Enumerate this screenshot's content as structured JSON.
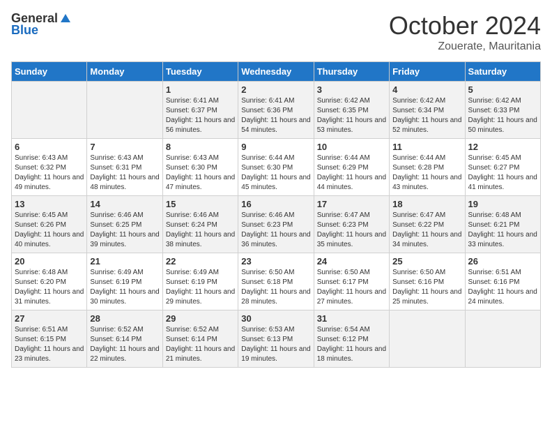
{
  "header": {
    "logo_general": "General",
    "logo_blue": "Blue",
    "month": "October 2024",
    "location": "Zouerate, Mauritania"
  },
  "days_of_week": [
    "Sunday",
    "Monday",
    "Tuesday",
    "Wednesday",
    "Thursday",
    "Friday",
    "Saturday"
  ],
  "weeks": [
    [
      {
        "day": "",
        "sunrise": "",
        "sunset": "",
        "daylight": ""
      },
      {
        "day": "",
        "sunrise": "",
        "sunset": "",
        "daylight": ""
      },
      {
        "day": "1",
        "sunrise": "Sunrise: 6:41 AM",
        "sunset": "Sunset: 6:37 PM",
        "daylight": "Daylight: 11 hours and 56 minutes."
      },
      {
        "day": "2",
        "sunrise": "Sunrise: 6:41 AM",
        "sunset": "Sunset: 6:36 PM",
        "daylight": "Daylight: 11 hours and 54 minutes."
      },
      {
        "day": "3",
        "sunrise": "Sunrise: 6:42 AM",
        "sunset": "Sunset: 6:35 PM",
        "daylight": "Daylight: 11 hours and 53 minutes."
      },
      {
        "day": "4",
        "sunrise": "Sunrise: 6:42 AM",
        "sunset": "Sunset: 6:34 PM",
        "daylight": "Daylight: 11 hours and 52 minutes."
      },
      {
        "day": "5",
        "sunrise": "Sunrise: 6:42 AM",
        "sunset": "Sunset: 6:33 PM",
        "daylight": "Daylight: 11 hours and 50 minutes."
      }
    ],
    [
      {
        "day": "6",
        "sunrise": "Sunrise: 6:43 AM",
        "sunset": "Sunset: 6:32 PM",
        "daylight": "Daylight: 11 hours and 49 minutes."
      },
      {
        "day": "7",
        "sunrise": "Sunrise: 6:43 AM",
        "sunset": "Sunset: 6:31 PM",
        "daylight": "Daylight: 11 hours and 48 minutes."
      },
      {
        "day": "8",
        "sunrise": "Sunrise: 6:43 AM",
        "sunset": "Sunset: 6:30 PM",
        "daylight": "Daylight: 11 hours and 47 minutes."
      },
      {
        "day": "9",
        "sunrise": "Sunrise: 6:44 AM",
        "sunset": "Sunset: 6:30 PM",
        "daylight": "Daylight: 11 hours and 45 minutes."
      },
      {
        "day": "10",
        "sunrise": "Sunrise: 6:44 AM",
        "sunset": "Sunset: 6:29 PM",
        "daylight": "Daylight: 11 hours and 44 minutes."
      },
      {
        "day": "11",
        "sunrise": "Sunrise: 6:44 AM",
        "sunset": "Sunset: 6:28 PM",
        "daylight": "Daylight: 11 hours and 43 minutes."
      },
      {
        "day": "12",
        "sunrise": "Sunrise: 6:45 AM",
        "sunset": "Sunset: 6:27 PM",
        "daylight": "Daylight: 11 hours and 41 minutes."
      }
    ],
    [
      {
        "day": "13",
        "sunrise": "Sunrise: 6:45 AM",
        "sunset": "Sunset: 6:26 PM",
        "daylight": "Daylight: 11 hours and 40 minutes."
      },
      {
        "day": "14",
        "sunrise": "Sunrise: 6:46 AM",
        "sunset": "Sunset: 6:25 PM",
        "daylight": "Daylight: 11 hours and 39 minutes."
      },
      {
        "day": "15",
        "sunrise": "Sunrise: 6:46 AM",
        "sunset": "Sunset: 6:24 PM",
        "daylight": "Daylight: 11 hours and 38 minutes."
      },
      {
        "day": "16",
        "sunrise": "Sunrise: 6:46 AM",
        "sunset": "Sunset: 6:23 PM",
        "daylight": "Daylight: 11 hours and 36 minutes."
      },
      {
        "day": "17",
        "sunrise": "Sunrise: 6:47 AM",
        "sunset": "Sunset: 6:23 PM",
        "daylight": "Daylight: 11 hours and 35 minutes."
      },
      {
        "day": "18",
        "sunrise": "Sunrise: 6:47 AM",
        "sunset": "Sunset: 6:22 PM",
        "daylight": "Daylight: 11 hours and 34 minutes."
      },
      {
        "day": "19",
        "sunrise": "Sunrise: 6:48 AM",
        "sunset": "Sunset: 6:21 PM",
        "daylight": "Daylight: 11 hours and 33 minutes."
      }
    ],
    [
      {
        "day": "20",
        "sunrise": "Sunrise: 6:48 AM",
        "sunset": "Sunset: 6:20 PM",
        "daylight": "Daylight: 11 hours and 31 minutes."
      },
      {
        "day": "21",
        "sunrise": "Sunrise: 6:49 AM",
        "sunset": "Sunset: 6:19 PM",
        "daylight": "Daylight: 11 hours and 30 minutes."
      },
      {
        "day": "22",
        "sunrise": "Sunrise: 6:49 AM",
        "sunset": "Sunset: 6:19 PM",
        "daylight": "Daylight: 11 hours and 29 minutes."
      },
      {
        "day": "23",
        "sunrise": "Sunrise: 6:50 AM",
        "sunset": "Sunset: 6:18 PM",
        "daylight": "Daylight: 11 hours and 28 minutes."
      },
      {
        "day": "24",
        "sunrise": "Sunrise: 6:50 AM",
        "sunset": "Sunset: 6:17 PM",
        "daylight": "Daylight: 11 hours and 27 minutes."
      },
      {
        "day": "25",
        "sunrise": "Sunrise: 6:50 AM",
        "sunset": "Sunset: 6:16 PM",
        "daylight": "Daylight: 11 hours and 25 minutes."
      },
      {
        "day": "26",
        "sunrise": "Sunrise: 6:51 AM",
        "sunset": "Sunset: 6:16 PM",
        "daylight": "Daylight: 11 hours and 24 minutes."
      }
    ],
    [
      {
        "day": "27",
        "sunrise": "Sunrise: 6:51 AM",
        "sunset": "Sunset: 6:15 PM",
        "daylight": "Daylight: 11 hours and 23 minutes."
      },
      {
        "day": "28",
        "sunrise": "Sunrise: 6:52 AM",
        "sunset": "Sunset: 6:14 PM",
        "daylight": "Daylight: 11 hours and 22 minutes."
      },
      {
        "day": "29",
        "sunrise": "Sunrise: 6:52 AM",
        "sunset": "Sunset: 6:14 PM",
        "daylight": "Daylight: 11 hours and 21 minutes."
      },
      {
        "day": "30",
        "sunrise": "Sunrise: 6:53 AM",
        "sunset": "Sunset: 6:13 PM",
        "daylight": "Daylight: 11 hours and 19 minutes."
      },
      {
        "day": "31",
        "sunrise": "Sunrise: 6:54 AM",
        "sunset": "Sunset: 6:12 PM",
        "daylight": "Daylight: 11 hours and 18 minutes."
      },
      {
        "day": "",
        "sunrise": "",
        "sunset": "",
        "daylight": ""
      },
      {
        "day": "",
        "sunrise": "",
        "sunset": "",
        "daylight": ""
      }
    ]
  ]
}
